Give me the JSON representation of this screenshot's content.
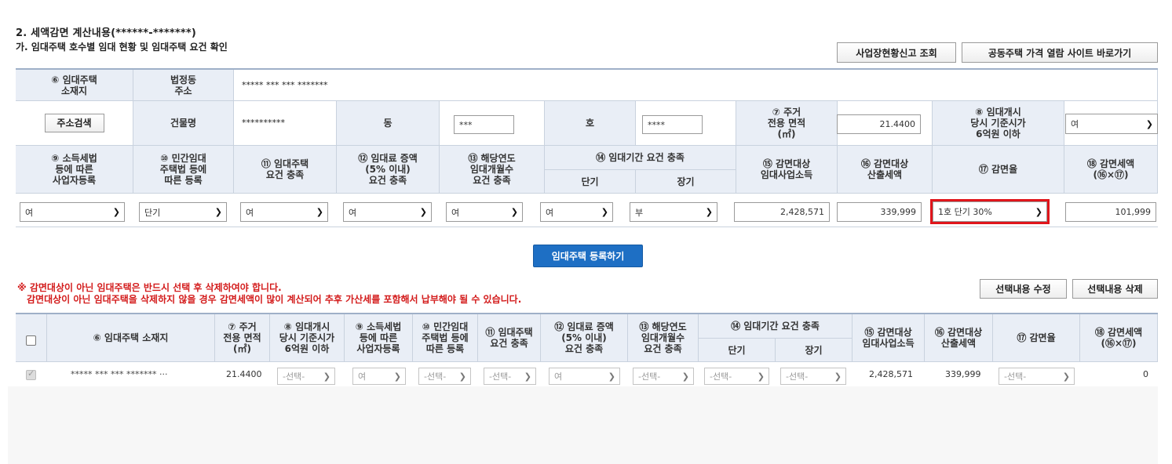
{
  "section": {
    "title": "2. 세액감면 계산내용(******-*******)",
    "subtitle": "가. 임대주택 호수별 임대 현황 및 임대주택 요건 확인"
  },
  "buttons": {
    "business_report": "사업장현황신고 조회",
    "price_site": "공동주택 가격 열람 사이트 바로가기",
    "address_search": "주소검색",
    "register": "임대주택 등록하기",
    "edit_selected": "선택내용 수정",
    "delete_selected": "선택내용 삭제"
  },
  "form": {
    "h_location": "⑥ 임대주택\n소재지",
    "h_legal_addr": "법정동\n주소",
    "legal_addr_value": "***** *** *** *******",
    "h_building": "건물명",
    "building_value": "**********",
    "h_dong": "동",
    "dong_value": "***",
    "h_ho": "호",
    "ho_value": "****",
    "h_area": "⑦ 주거\n전용 면적\n(㎡)",
    "area_value": "21.4400",
    "h_price": "⑧ 임대개시\n당시 기준시가\n6억원 이하",
    "price_value": "여",
    "h9": "⑨ 소득세법\n등에 따른\n사업자등록",
    "h10": "⑩ 민간임대\n주택법 등에\n따른 등록",
    "h11": "⑪ 임대주택\n요건 충족",
    "h12": "⑫ 임대료 증액\n(5% 이내)\n요건 충족",
    "h13": "⑬ 해당연도\n임대개월수\n요건 충족",
    "h14": "⑭ 임대기간 요건 충족",
    "h14_short": "단기",
    "h14_long": "장기",
    "h15": "⑮ 감면대상\n임대사업소득",
    "h16": "⑯ 감면대상\n산출세액",
    "h17": "⑰ 감면율",
    "h18": "⑱ 감면세액\n(⑯×⑰)",
    "v9": "여",
    "v10": "단기",
    "v11": "여",
    "v12": "여",
    "v13": "여",
    "v14_short": "여",
    "v14_long": "부",
    "v15": "2,428,571",
    "v16": "339,999",
    "v17": "1호 단기 30%",
    "v18": "101,999"
  },
  "warning": {
    "line1": "※ 감면대상이 아닌 임대주택은 반드시 선택 후 삭제하여야 합니다.",
    "line2": "감면대상이 아닌 임대주택을 삭제하지 않을 경우 감면세액이 많이 계산되어 추후 가산세를 포함해서 납부해야 될 수 있습니다."
  },
  "list": {
    "headers": {
      "location": "⑥ 임대주택 소재지",
      "area": "⑦ 주거\n전용 면적\n(㎡)",
      "price": "⑧ 임대개시\n당시 기준시가\n6억원 이하",
      "h9": "⑨ 소득세법\n등에 따른\n사업자등록",
      "h10": "⑩ 민간임대\n주택법 등에\n따른 등록",
      "h11": "⑪ 임대주택\n요건 충족",
      "h12": "⑫ 임대료 증액\n(5% 이내)\n요건 충족",
      "h13": "⑬ 해당연도\n임대개월수\n요건 충족",
      "h14": "⑭ 임대기간 요건 충족",
      "h14_short": "단기",
      "h14_long": "장기",
      "h15": "⑮ 감면대상\n임대사업소득",
      "h16": "⑯ 감면대상\n산출세액",
      "h17": "⑰ 감면율",
      "h18": "⑱ 감면세액\n(⑯×⑰)"
    },
    "row": {
      "location": "***** *** *** ******* ···",
      "area": "21.4400",
      "price": "-선택-",
      "h9": "여",
      "h10": "-선택-",
      "h11": "-선택-",
      "h12": "여",
      "h13": "-선택-",
      "h14_short": "-선택-",
      "h14_long": "-선택-",
      "h15": "2,428,571",
      "h16": "339,999",
      "h17": "-선택-",
      "h18": "0"
    }
  },
  "colors": {
    "header_bg": "#e9eef6",
    "accent_blue": "#1e6fc4",
    "warning_red": "#d31b1b",
    "highlight": "#e0151b"
  }
}
